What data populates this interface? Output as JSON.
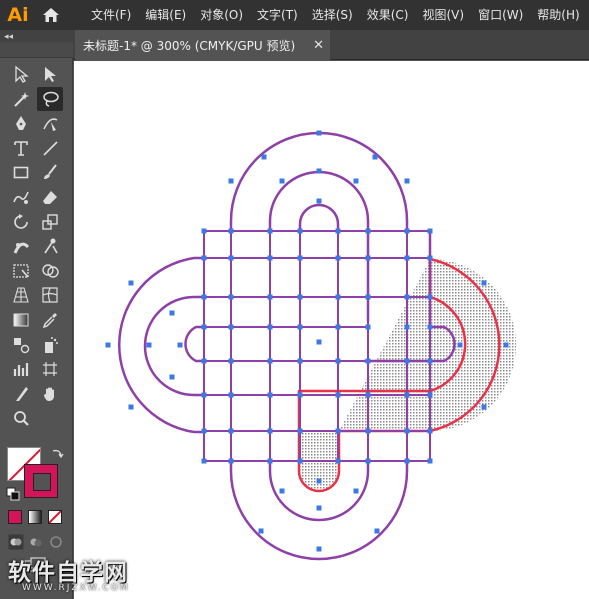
{
  "app": {
    "logo_text": "Ai",
    "brand_color": "#ff9a00"
  },
  "menu": {
    "items": [
      "文件(F)",
      "编辑(E)",
      "对象(O)",
      "文字(T)",
      "选择(S)",
      "效果(C)",
      "视图(V)",
      "窗口(W)",
      "帮助(H)"
    ]
  },
  "tabs": {
    "collapse_glyph": "◂◂",
    "active_label": "未标题-1* @ 300% (CMYK/GPU 预览)",
    "close_glyph": "✕"
  },
  "toolbar": {
    "fill_color": "#ffffff",
    "stroke_color": "#d4145a",
    "tools": [
      "selection-icon",
      "direct-selection-icon",
      "magic-wand-icon",
      "lasso-icon",
      "pen-icon",
      "curvature-icon",
      "type-icon",
      "line-segment-icon",
      "rectangle-icon",
      "paintbrush-icon",
      "shaper-icon",
      "eraser-icon",
      "rotate-icon",
      "scale-icon",
      "width-icon",
      "puppet-warp-icon",
      "free-transform-icon",
      "shape-builder-icon",
      "perspective-grid-icon",
      "mesh-icon",
      "gradient-icon",
      "eyedropper-icon",
      "blend-icon",
      "symbol-sprayer-icon",
      "column-graph-icon",
      "artboard-icon",
      "slice-icon",
      "hand-icon",
      "zoom-icon"
    ]
  },
  "artwork": {
    "stroke_purple": "#8e3fa8",
    "stroke_red": "#e8324a",
    "anchor_color": "#3c78e6"
  },
  "watermark": {
    "main": "软件自学网",
    "sub": "WWW.RJZXW.COM"
  }
}
